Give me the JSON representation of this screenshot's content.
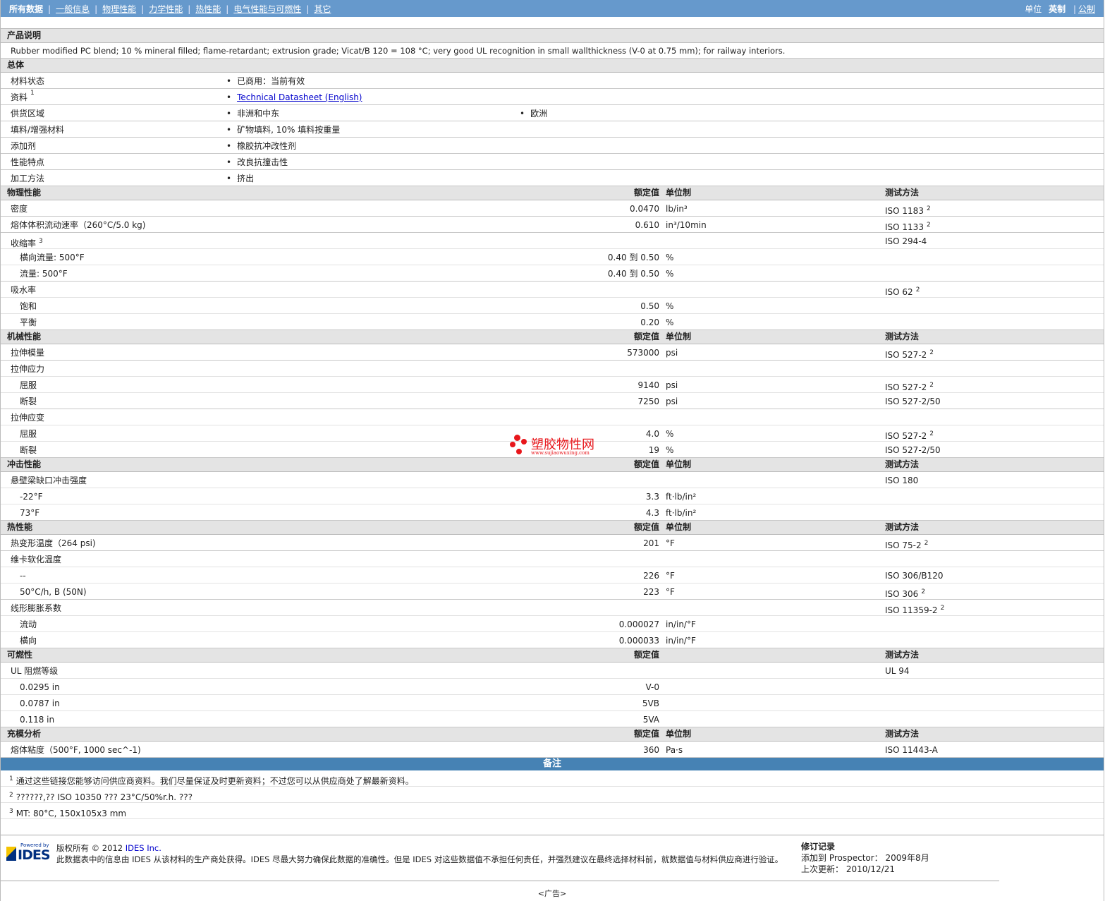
{
  "nav": {
    "items": [
      "所有数据",
      "一般信息",
      "物理性能",
      "力学性能",
      "热性能",
      "电气性能与可燃性",
      "其它"
    ],
    "units_label": "单位",
    "unit_imperial": "英制",
    "unit_metric": "公制"
  },
  "product": {
    "title": "产品说明",
    "description": "Rubber modified PC blend; 10 % mineral filled; flame-retardant; extrusion grade; Vicat/B 120 = 108 °C; very good UL recognition in small wallthickness (V-0 at 0.75 mm); for railway interiors."
  },
  "general": {
    "title": "总体",
    "rows": [
      {
        "label": "材料状态",
        "items": [
          "已商用：当前有效"
        ]
      },
      {
        "label": "资料",
        "sup": "1",
        "link": "Technical Datasheet (English)"
      },
      {
        "label": "供货区域",
        "items": [
          "非洲和中东",
          "欧洲"
        ]
      },
      {
        "label": "填料/增强材料",
        "items": [
          "矿物填料, 10% 填料按重量"
        ]
      },
      {
        "label": "添加剂",
        "items": [
          "橡胶抗冲改性剂"
        ]
      },
      {
        "label": "性能特点",
        "items": [
          "改良抗撞击性"
        ]
      },
      {
        "label": "加工方法",
        "items": [
          "挤出"
        ]
      }
    ]
  },
  "col_headers": {
    "value": "额定值",
    "unit": "单位制",
    "method": "测试方法"
  },
  "sections": [
    {
      "title": "物理性能",
      "unit_col": true,
      "rows": [
        {
          "label": "密度",
          "value": "0.0470",
          "unit": "lb/in³",
          "method": "ISO 1183",
          "msup": "2",
          "grp": true
        },
        {
          "label": "熔体体积流动速率（260°C/5.0 kg)",
          "value": "0.610",
          "unit": "in³/10min",
          "method": "ISO 1133",
          "msup": "2",
          "grp": true
        },
        {
          "label": "收缩率",
          "sup": "3",
          "method": "ISO 294-4"
        },
        {
          "label": "横向流量: 500°F",
          "sub": true,
          "value": "0.40 到  0.50",
          "unit": "%"
        },
        {
          "label": "流量: 500°F",
          "sub": true,
          "value": "0.40 到  0.50",
          "unit": "%",
          "grp": true
        },
        {
          "label": "吸水率",
          "method": "ISO 62",
          "msup": "2"
        },
        {
          "label": "饱和",
          "sub": true,
          "value": "0.50",
          "unit": "%"
        },
        {
          "label": "平衡",
          "sub": true,
          "value": "0.20",
          "unit": "%"
        }
      ]
    },
    {
      "title": "机械性能",
      "unit_col": true,
      "rows": [
        {
          "label": "拉伸模量",
          "value": "573000",
          "unit": "psi",
          "method": "ISO 527-2",
          "msup": "2",
          "grp": true
        },
        {
          "label": "拉伸应力"
        },
        {
          "label": "屈服",
          "sub": true,
          "value": "9140",
          "unit": "psi",
          "method": "ISO 527-2",
          "msup": "2"
        },
        {
          "label": "断裂",
          "sub": true,
          "value": "7250",
          "unit": "psi",
          "method": "ISO 527-2/50",
          "grp": true
        },
        {
          "label": "拉伸应变"
        },
        {
          "label": "屈服",
          "sub": true,
          "value": "4.0",
          "unit": "%",
          "method": "ISO 527-2",
          "msup": "2"
        },
        {
          "label": "断裂",
          "sub": true,
          "value": "19",
          "unit": "%",
          "method": "ISO 527-2/50"
        }
      ]
    },
    {
      "title": "冲击性能",
      "unit_col": true,
      "rows": [
        {
          "label": "悬壁梁缺口冲击强度",
          "method": "ISO 180"
        },
        {
          "label": "-22°F",
          "sub": true,
          "value": "3.3",
          "unit": "ft·lb/in²"
        },
        {
          "label": "73°F",
          "sub": true,
          "value": "4.3",
          "unit": "ft·lb/in²"
        }
      ]
    },
    {
      "title": "热性能",
      "unit_col": true,
      "rows": [
        {
          "label": "热变形温度（264 psi)",
          "value": "201",
          "unit": "°F",
          "method": "ISO 75-2",
          "msup": "2",
          "grp": true
        },
        {
          "label": "维卡软化温度"
        },
        {
          "label": "--",
          "sub": true,
          "value": "226",
          "unit": "°F",
          "method": "ISO 306/B120"
        },
        {
          "label": "50°C/h, B (50N)",
          "sub": true,
          "value": "223",
          "unit": "°F",
          "method": "ISO 306",
          "msup": "2",
          "grp": true
        },
        {
          "label": "线形膨胀系数",
          "method": "ISO 11359-2",
          "msup": "2"
        },
        {
          "label": "流动",
          "sub": true,
          "value": "0.000027",
          "unit": "in/in/°F"
        },
        {
          "label": "横向",
          "sub": true,
          "value": "0.000033",
          "unit": "in/in/°F"
        }
      ]
    },
    {
      "title": "可燃性",
      "unit_col": false,
      "rows": [
        {
          "label": "UL 阻燃等级",
          "method": "UL 94"
        },
        {
          "label": "0.0295 in",
          "sub": true,
          "value": "V-0"
        },
        {
          "label": "0.0787 in",
          "sub": true,
          "value": "5VB"
        },
        {
          "label": "0.118 in",
          "sub": true,
          "value": "5VA"
        }
      ]
    },
    {
      "title": "充模分析",
      "unit_col": true,
      "rows": [
        {
          "label": "熔体粘度（500°F, 1000 sec^-1)",
          "value": "360",
          "unit": "Pa·s",
          "method": "ISO 11443-A"
        }
      ]
    }
  ],
  "notes": {
    "title": "备注",
    "items": [
      {
        "num": "1",
        "text": "通过这些链接您能够访问供应商资料。我们尽量保证及时更新资料；不过您可以从供应商处了解最新资料。"
      },
      {
        "num": "2",
        "text": "??????,?? ISO 10350 ??? 23°C/50%r.h. ???"
      },
      {
        "num": "3",
        "text": "MT: 80°C, 150x105x3 mm"
      }
    ]
  },
  "footer": {
    "logo_powered": "Powered by",
    "logo_text": "IDES",
    "copyright": "版权所有 © 2012 ",
    "company_link": "IDES Inc.",
    "disclaimer": "此数据表中的信息由 IDES 从该材料的生产商处获得。IDES 尽最大努力确保此数据的准确性。但是 IDES 对这些数据值不承担任何责任，并强烈建议在最终选择材料前，就数据值与材料供应商进行验证。",
    "revision_title": "修订记录",
    "added_label": "添加到 Prospector：",
    "added_date": "2009年8月",
    "updated_label": "上次更新：",
    "updated_date": "2010/12/21",
    "ad": "<广告>"
  },
  "watermark": {
    "text": "塑胶物性网",
    "url": "www.sujiaowuxing.com"
  }
}
